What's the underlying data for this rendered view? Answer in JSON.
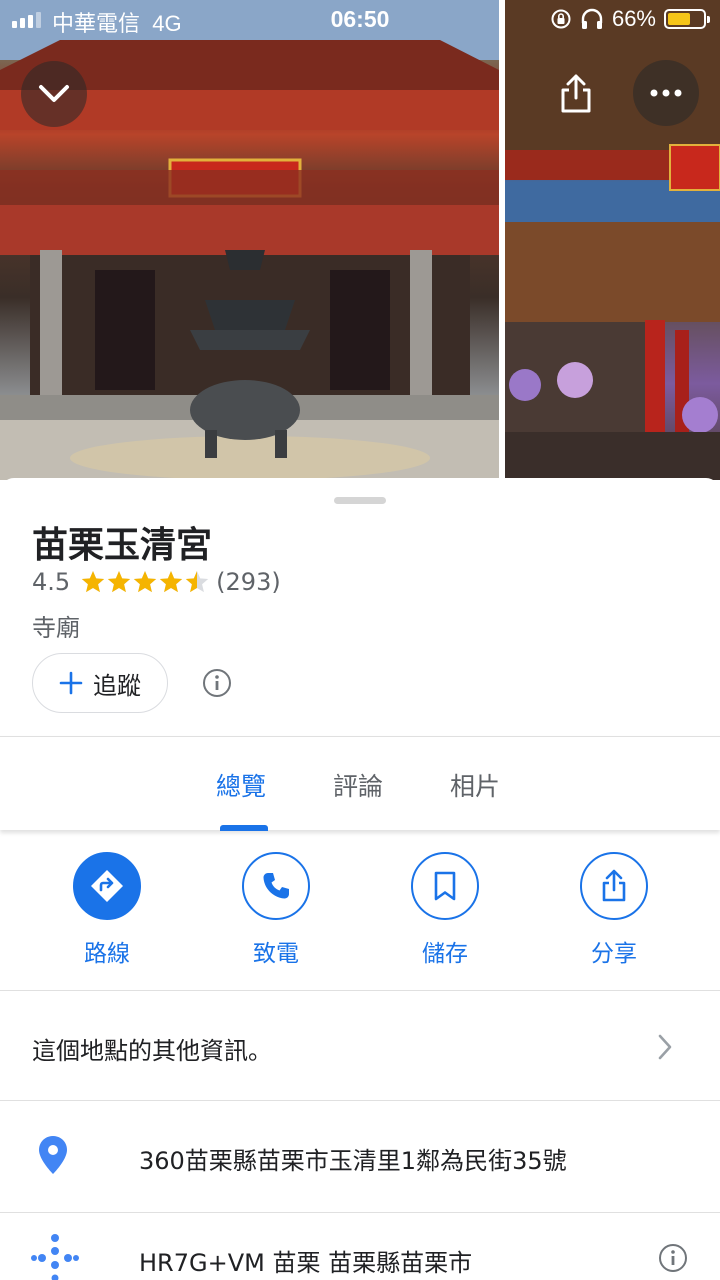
{
  "status_bar": {
    "carrier": "中華電信",
    "network": "4G",
    "time": "06:50",
    "battery": "66%",
    "battery_level": 0.66,
    "battery_color": "#f5c518"
  },
  "header": {
    "collapse_icon": "chevron-down-icon",
    "share_icon": "share-icon",
    "more_icon": "more-icon"
  },
  "place": {
    "name": "苗栗玉清宮",
    "rating": "4.5",
    "rating_value": 4.5,
    "review_count": "(293)",
    "category": "寺廟",
    "follow_label": "追蹤",
    "star_color": "#f5b400"
  },
  "tabs": [
    {
      "label": "總覽",
      "active": true
    },
    {
      "label": "評論",
      "active": false
    },
    {
      "label": "相片",
      "active": false
    }
  ],
  "actions": [
    {
      "label": "路線",
      "icon": "directions-icon"
    },
    {
      "label": "致電",
      "icon": "phone-icon"
    },
    {
      "label": "儲存",
      "icon": "bookmark-icon"
    },
    {
      "label": "分享",
      "icon": "share-icon"
    }
  ],
  "more_info": {
    "label": "這個地點的其他資訊。"
  },
  "address": {
    "text": "360苗栗縣苗栗市玉清里1鄰為民街35號"
  },
  "plus_code": {
    "text": "HR7G+VM 苗栗 苗栗縣苗栗市"
  },
  "colors": {
    "accent": "#1a73e8",
    "text": "#202124",
    "secondary": "#5f6368"
  }
}
